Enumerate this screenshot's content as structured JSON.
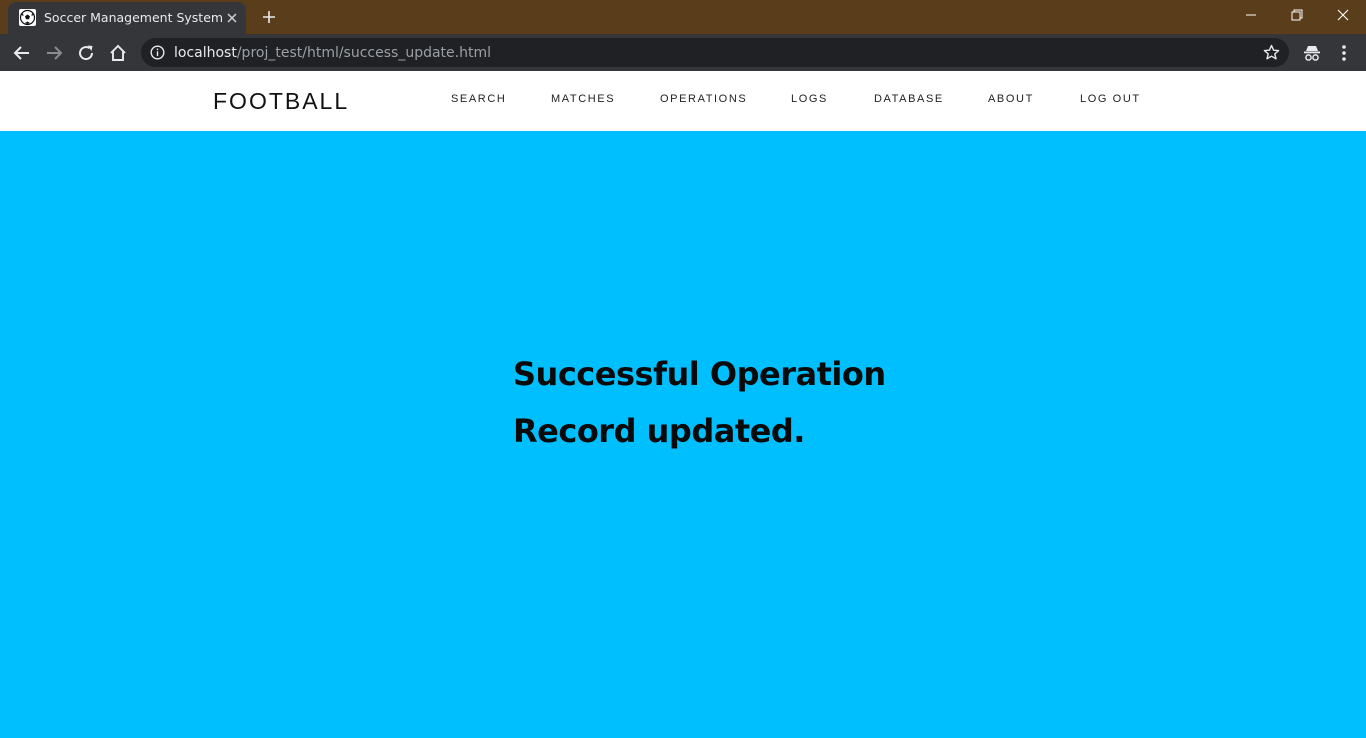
{
  "browser": {
    "tab_title": "Soccer Management System",
    "url_host": "localhost",
    "url_path": "/proj_test/html/success_update.html",
    "icons": [
      "soccer-ball-icon",
      "close-icon",
      "plus-icon",
      "minimize-icon",
      "restore-icon",
      "window-close-icon",
      "back-arrow-icon",
      "forward-arrow-icon",
      "reload-icon",
      "home-icon",
      "info-icon",
      "star-icon",
      "incognito-icon",
      "kebab-menu-icon"
    ]
  },
  "nav": {
    "brand": "FOOTBALL",
    "links": [
      "SEARCH",
      "MATCHES",
      "OPERATIONS",
      "LOGS",
      "DATABASE",
      "ABOUT",
      "LOG OUT"
    ]
  },
  "main": {
    "title": "Successful Operation",
    "message": "Record updated."
  },
  "colors": {
    "background": "#00bfff",
    "titlebar": "#5a3e1b",
    "toolbar": "#35363a",
    "nav_background": "#ffffff"
  }
}
